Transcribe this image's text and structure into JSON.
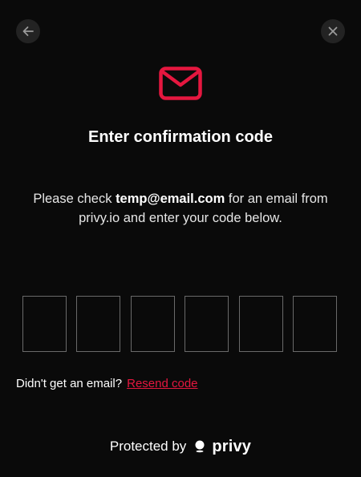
{
  "header": {
    "back_icon": "arrow-left-icon",
    "close_icon": "close-icon"
  },
  "main": {
    "icon": "mail-icon",
    "title": "Enter confirmation code",
    "description_prefix": "Please check ",
    "email": "temp@email.com",
    "description_suffix": " for an email from privy.io and enter your code below.",
    "code_inputs": [
      "",
      "",
      "",
      "",
      "",
      ""
    ]
  },
  "resend": {
    "prompt": "Didn't get an email?",
    "link_label": "Resend code"
  },
  "footer": {
    "protected_by": "Protected by",
    "brand": "privy"
  },
  "colors": {
    "background": "#0a0a0a",
    "accent": "#e5173f",
    "input_border": "#6a6a6a",
    "icon_button_bg": "#232323"
  }
}
